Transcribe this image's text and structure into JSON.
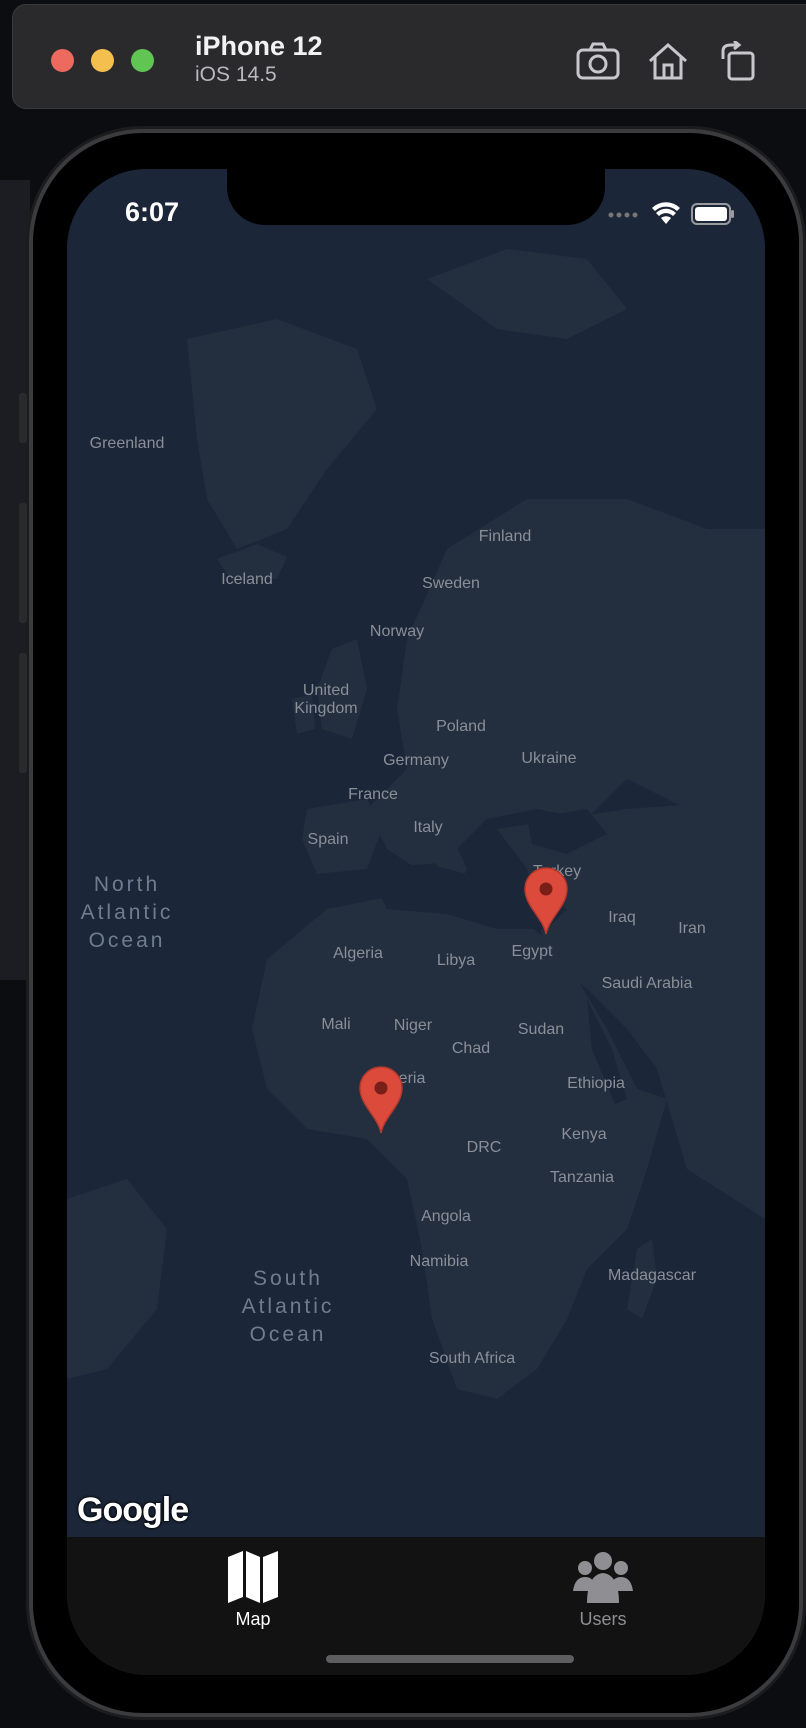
{
  "simulator": {
    "device_name": "iPhone 12",
    "os_version": "iOS 14.5",
    "toolbar_icons": [
      "screenshot-icon",
      "home-icon",
      "rotate-icon"
    ]
  },
  "status_bar": {
    "time": "6:07",
    "icons": [
      "cellular-icon",
      "wifi-icon",
      "battery-icon"
    ]
  },
  "map": {
    "provider_logo": "Google",
    "country_labels": [
      {
        "name": "Greenland"
      },
      {
        "name": "Iceland"
      },
      {
        "name": "Finland"
      },
      {
        "name": "Sweden"
      },
      {
        "name": "Norway"
      },
      {
        "name": "United\nKingdom"
      },
      {
        "name": "Poland"
      },
      {
        "name": "Germany"
      },
      {
        "name": "Ukraine"
      },
      {
        "name": "France"
      },
      {
        "name": "Italy"
      },
      {
        "name": "Spain"
      },
      {
        "name": "Turkey"
      },
      {
        "name": "Iraq"
      },
      {
        "name": "Iran"
      },
      {
        "name": "Algeria"
      },
      {
        "name": "Libya"
      },
      {
        "name": "Egypt"
      },
      {
        "name": "Saudi Arabia"
      },
      {
        "name": "Mali"
      },
      {
        "name": "Niger"
      },
      {
        "name": "Sudan"
      },
      {
        "name": "Chad"
      },
      {
        "name": "Nigeria"
      },
      {
        "name": "Ethiopia"
      },
      {
        "name": "Kenya"
      },
      {
        "name": "DRC"
      },
      {
        "name": "Tanzania"
      },
      {
        "name": "Angola"
      },
      {
        "name": "Namibia"
      },
      {
        "name": "Madagascar"
      },
      {
        "name": "South Africa"
      }
    ],
    "ocean_labels": [
      {
        "name": "North\nAtlantic\nOcean"
      },
      {
        "name": "South\nAtlantic\nOcean"
      }
    ],
    "markers": [
      {
        "name": "marker-egypt",
        "color": "#db4a3b"
      },
      {
        "name": "marker-nigeria",
        "color": "#db4a3b"
      }
    ]
  },
  "tab_bar": {
    "tabs": [
      {
        "label": "Map",
        "icon": "map-icon",
        "selected": true
      },
      {
        "label": "Users",
        "icon": "users-icon",
        "selected": false
      }
    ],
    "colors": {
      "selected": "#ffffff",
      "unselected": "#8e8e93"
    }
  }
}
